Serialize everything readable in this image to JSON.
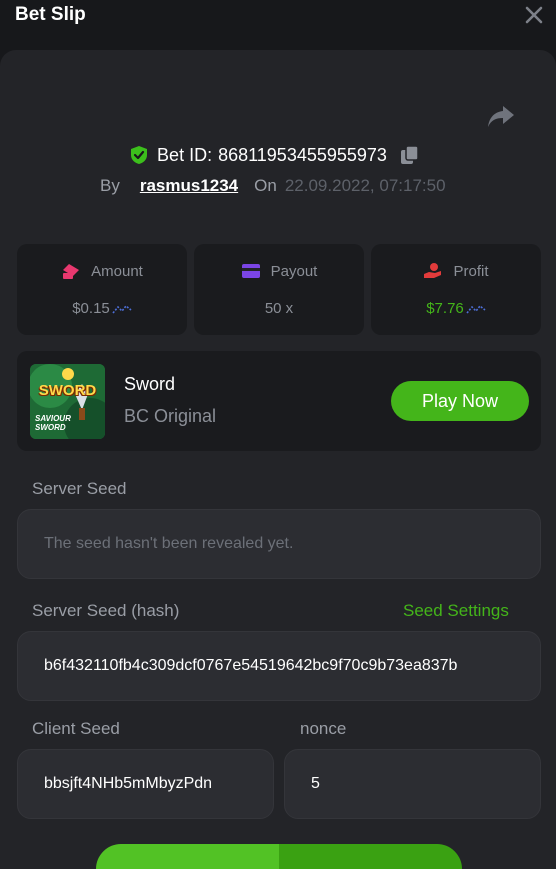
{
  "header": {
    "title": "Bet Slip"
  },
  "bet": {
    "id_label": "Bet ID:",
    "id_value": "86811953455955973",
    "by_label": "By",
    "username": "rasmus1234",
    "on_label": "On",
    "datetime": "22.09.2022, 07:17:50"
  },
  "stats": [
    {
      "label": "Amount",
      "value": "$0.15",
      "icon": "coins-icon",
      "value_color": "#8b8f97"
    },
    {
      "label": "Payout",
      "value": "50 x",
      "icon": "card-icon",
      "value_color": "#8b8f97"
    },
    {
      "label": "Profit",
      "value": "$7.76",
      "icon": "hand-coin-icon",
      "value_color": "#44b51a"
    }
  ],
  "game": {
    "thumb_title": "SWORD",
    "thumb_subtitle": "SAVIOUR SWORD",
    "name": "Sword",
    "provider": "BC Original",
    "play_label": "Play Now"
  },
  "server_seed": {
    "label": "Server Seed",
    "placeholder": "The seed hasn't been revealed yet."
  },
  "server_seed_hash": {
    "label": "Server Seed (hash)",
    "settings_link": "Seed Settings",
    "value": "b6f432110fb4c309dcf0767e54519642bc9f70c9b73ea837b"
  },
  "client_seed": {
    "label": "Client Seed",
    "value": "bbsjft4NHb5mMbyzPdn"
  },
  "nonce": {
    "label": "nonce",
    "value": "5"
  },
  "colors": {
    "accent": "#44b51a",
    "panel": "#232428",
    "card": "#1a1b1e"
  }
}
